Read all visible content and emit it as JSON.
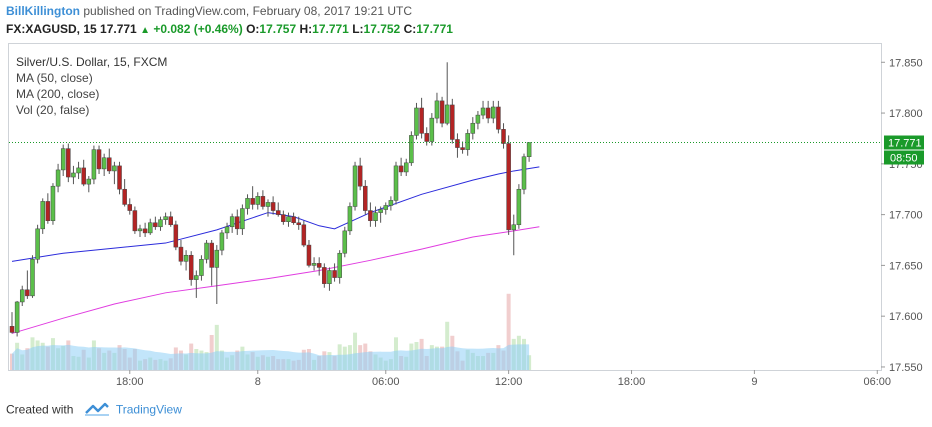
{
  "header": {
    "author": "BillKillington",
    "published": "published on TradingView.com, February 08, 2017 19:21 UTC",
    "symbol": "FX:XAGUSD, 15",
    "last": "17.771",
    "change": "+0.082 (+0.46%)",
    "o_label": "O:",
    "o": "17.757",
    "h_label": "H:",
    "h": "17.771",
    "l_label": "L:",
    "l": "17.752",
    "c_label": "C:",
    "c": "17.771"
  },
  "legend": {
    "title": "Silver/U.S. Dollar, 15, FXCM",
    "ma50": "MA (50, close)",
    "ma200": "MA (200, close)",
    "vol": "Vol (20, false)"
  },
  "footer": {
    "created_with": "Created with",
    "brand": "TradingView"
  },
  "colors": {
    "up": "#5bbf4a",
    "down": "#b32424",
    "ma50": "#2b2bdb",
    "ma200": "#e03ce0",
    "vol_avg": "#8fd0f5",
    "last_price_tag": "#1a9a2a",
    "dotted_line": "#1a9a2a"
  },
  "chart_data": {
    "type": "candlestick",
    "title": "Silver/U.S. Dollar, 15, FXCM",
    "y_ticks": [
      17.55,
      17.6,
      17.65,
      17.7,
      17.75,
      17.8,
      17.85
    ],
    "y_tick_labels": [
      "17.550",
      "17.600",
      "17.650",
      "17.700",
      "17.750",
      "17.800",
      "17.850"
    ],
    "ylim": [
      17.547,
      17.868
    ],
    "x_tick_labels": [
      "18:00",
      "8",
      "06:00",
      "12:00",
      "18:00",
      "9",
      "06:00"
    ],
    "x_tick_bar_index": [
      23,
      48,
      73,
      97,
      121,
      145,
      169
    ],
    "last_price": "17.771",
    "countdown": "08:50",
    "candles": [
      {
        "o": 17.59,
        "h": 17.604,
        "l": 17.583,
        "c": 17.584
      },
      {
        "o": 17.584,
        "h": 17.615,
        "l": 17.58,
        "c": 17.614
      },
      {
        "o": 17.614,
        "h": 17.63,
        "l": 17.61,
        "c": 17.626
      },
      {
        "o": 17.626,
        "h": 17.645,
        "l": 17.617,
        "c": 17.62
      },
      {
        "o": 17.62,
        "h": 17.66,
        "l": 17.618,
        "c": 17.656
      },
      {
        "o": 17.656,
        "h": 17.69,
        "l": 17.652,
        "c": 17.686
      },
      {
        "o": 17.686,
        "h": 17.716,
        "l": 17.681,
        "c": 17.713
      },
      {
        "o": 17.713,
        "h": 17.721,
        "l": 17.691,
        "c": 17.694
      },
      {
        "o": 17.694,
        "h": 17.731,
        "l": 17.69,
        "c": 17.728
      },
      {
        "o": 17.728,
        "h": 17.75,
        "l": 17.722,
        "c": 17.744
      },
      {
        "o": 17.744,
        "h": 17.769,
        "l": 17.738,
        "c": 17.765
      },
      {
        "o": 17.765,
        "h": 17.77,
        "l": 17.732,
        "c": 17.737
      },
      {
        "o": 17.737,
        "h": 17.748,
        "l": 17.73,
        "c": 17.741
      },
      {
        "o": 17.741,
        "h": 17.752,
        "l": 17.735,
        "c": 17.746
      },
      {
        "o": 17.746,
        "h": 17.754,
        "l": 17.728,
        "c": 17.73
      },
      {
        "o": 17.73,
        "h": 17.738,
        "l": 17.722,
        "c": 17.735
      },
      {
        "o": 17.735,
        "h": 17.768,
        "l": 17.73,
        "c": 17.764
      },
      {
        "o": 17.764,
        "h": 17.768,
        "l": 17.74,
        "c": 17.745
      },
      {
        "o": 17.745,
        "h": 17.76,
        "l": 17.738,
        "c": 17.756
      },
      {
        "o": 17.756,
        "h": 17.765,
        "l": 17.74,
        "c": 17.743
      },
      {
        "o": 17.743,
        "h": 17.752,
        "l": 17.73,
        "c": 17.748
      },
      {
        "o": 17.748,
        "h": 17.752,
        "l": 17.72,
        "c": 17.725
      },
      {
        "o": 17.725,
        "h": 17.735,
        "l": 17.708,
        "c": 17.71
      },
      {
        "o": 17.71,
        "h": 17.716,
        "l": 17.7,
        "c": 17.704
      },
      {
        "o": 17.704,
        "h": 17.708,
        "l": 17.681,
        "c": 17.684
      },
      {
        "o": 17.684,
        "h": 17.69,
        "l": 17.678,
        "c": 17.686
      },
      {
        "o": 17.686,
        "h": 17.692,
        "l": 17.678,
        "c": 17.682
      },
      {
        "o": 17.682,
        "h": 17.696,
        "l": 17.68,
        "c": 17.692
      },
      {
        "o": 17.692,
        "h": 17.698,
        "l": 17.685,
        "c": 17.688
      },
      {
        "o": 17.688,
        "h": 17.698,
        "l": 17.684,
        "c": 17.695
      },
      {
        "o": 17.695,
        "h": 17.702,
        "l": 17.69,
        "c": 17.698
      },
      {
        "o": 17.698,
        "h": 17.703,
        "l": 17.688,
        "c": 17.69
      },
      {
        "o": 17.69,
        "h": 17.694,
        "l": 17.665,
        "c": 17.668
      },
      {
        "o": 17.668,
        "h": 17.675,
        "l": 17.65,
        "c": 17.654
      },
      {
        "o": 17.654,
        "h": 17.665,
        "l": 17.645,
        "c": 17.66
      },
      {
        "o": 17.66,
        "h": 17.664,
        "l": 17.63,
        "c": 17.636
      },
      {
        "o": 17.636,
        "h": 17.645,
        "l": 17.618,
        "c": 17.64
      },
      {
        "o": 17.64,
        "h": 17.66,
        "l": 17.635,
        "c": 17.656
      },
      {
        "o": 17.656,
        "h": 17.675,
        "l": 17.652,
        "c": 17.672
      },
      {
        "o": 17.672,
        "h": 17.675,
        "l": 17.63,
        "c": 17.648
      },
      {
        "o": 17.648,
        "h": 17.67,
        "l": 17.612,
        "c": 17.665
      },
      {
        "o": 17.665,
        "h": 17.685,
        "l": 17.66,
        "c": 17.682
      },
      {
        "o": 17.682,
        "h": 17.692,
        "l": 17.676,
        "c": 17.688
      },
      {
        "o": 17.688,
        "h": 17.701,
        "l": 17.682,
        "c": 17.698
      },
      {
        "o": 17.698,
        "h": 17.705,
        "l": 17.68,
        "c": 17.686
      },
      {
        "o": 17.686,
        "h": 17.71,
        "l": 17.68,
        "c": 17.706
      },
      {
        "o": 17.706,
        "h": 17.72,
        "l": 17.7,
        "c": 17.716
      },
      {
        "o": 17.716,
        "h": 17.728,
        "l": 17.705,
        "c": 17.71
      },
      {
        "o": 17.71,
        "h": 17.722,
        "l": 17.705,
        "c": 17.718
      },
      {
        "o": 17.718,
        "h": 17.724,
        "l": 17.705,
        "c": 17.708
      },
      {
        "o": 17.708,
        "h": 17.715,
        "l": 17.698,
        "c": 17.712
      },
      {
        "o": 17.712,
        "h": 17.718,
        "l": 17.7,
        "c": 17.704
      },
      {
        "o": 17.704,
        "h": 17.712,
        "l": 17.698,
        "c": 17.7
      },
      {
        "o": 17.7,
        "h": 17.704,
        "l": 17.69,
        "c": 17.693
      },
      {
        "o": 17.693,
        "h": 17.702,
        "l": 17.688,
        "c": 17.698
      },
      {
        "o": 17.698,
        "h": 17.702,
        "l": 17.69,
        "c": 17.692
      },
      {
        "o": 17.692,
        "h": 17.698,
        "l": 17.685,
        "c": 17.69
      },
      {
        "o": 17.69,
        "h": 17.694,
        "l": 17.668,
        "c": 17.67
      },
      {
        "o": 17.67,
        "h": 17.675,
        "l": 17.648,
        "c": 17.65
      },
      {
        "o": 17.65,
        "h": 17.658,
        "l": 17.645,
        "c": 17.652
      },
      {
        "o": 17.652,
        "h": 17.658,
        "l": 17.64,
        "c": 17.648
      },
      {
        "o": 17.648,
        "h": 17.652,
        "l": 17.628,
        "c": 17.632
      },
      {
        "o": 17.632,
        "h": 17.648,
        "l": 17.625,
        "c": 17.645
      },
      {
        "o": 17.645,
        "h": 17.652,
        "l": 17.634,
        "c": 17.638
      },
      {
        "o": 17.638,
        "h": 17.665,
        "l": 17.632,
        "c": 17.662
      },
      {
        "o": 17.662,
        "h": 17.688,
        "l": 17.658,
        "c": 17.684
      },
      {
        "o": 17.684,
        "h": 17.712,
        "l": 17.68,
        "c": 17.708
      },
      {
        "o": 17.708,
        "h": 17.752,
        "l": 17.704,
        "c": 17.748
      },
      {
        "o": 17.748,
        "h": 17.756,
        "l": 17.724,
        "c": 17.728
      },
      {
        "o": 17.728,
        "h": 17.734,
        "l": 17.7,
        "c": 17.704
      },
      {
        "o": 17.704,
        "h": 17.712,
        "l": 17.688,
        "c": 17.694
      },
      {
        "o": 17.694,
        "h": 17.708,
        "l": 17.688,
        "c": 17.702
      },
      {
        "o": 17.702,
        "h": 17.708,
        "l": 17.692,
        "c": 17.705
      },
      {
        "o": 17.705,
        "h": 17.712,
        "l": 17.7,
        "c": 17.709
      },
      {
        "o": 17.709,
        "h": 17.718,
        "l": 17.704,
        "c": 17.714
      },
      {
        "o": 17.714,
        "h": 17.752,
        "l": 17.71,
        "c": 17.748
      },
      {
        "o": 17.748,
        "h": 17.756,
        "l": 17.738,
        "c": 17.742
      },
      {
        "o": 17.742,
        "h": 17.755,
        "l": 17.738,
        "c": 17.751
      },
      {
        "o": 17.751,
        "h": 17.782,
        "l": 17.748,
        "c": 17.778
      },
      {
        "o": 17.778,
        "h": 17.81,
        "l": 17.774,
        "c": 17.805
      },
      {
        "o": 17.805,
        "h": 17.815,
        "l": 17.775,
        "c": 17.78
      },
      {
        "o": 17.78,
        "h": 17.786,
        "l": 17.768,
        "c": 17.772
      },
      {
        "o": 17.772,
        "h": 17.8,
        "l": 17.768,
        "c": 17.795
      },
      {
        "o": 17.795,
        "h": 17.82,
        "l": 17.79,
        "c": 17.812
      },
      {
        "o": 17.812,
        "h": 17.816,
        "l": 17.786,
        "c": 17.79
      },
      {
        "o": 17.79,
        "h": 17.85,
        "l": 17.788,
        "c": 17.808
      },
      {
        "o": 17.808,
        "h": 17.814,
        "l": 17.77,
        "c": 17.774
      },
      {
        "o": 17.774,
        "h": 17.78,
        "l": 17.756,
        "c": 17.766
      },
      {
        "o": 17.766,
        "h": 17.772,
        "l": 17.76,
        "c": 17.764
      },
      {
        "o": 17.764,
        "h": 17.784,
        "l": 17.758,
        "c": 17.78
      },
      {
        "o": 17.78,
        "h": 17.796,
        "l": 17.774,
        "c": 17.79
      },
      {
        "o": 17.79,
        "h": 17.802,
        "l": 17.784,
        "c": 17.798
      },
      {
        "o": 17.798,
        "h": 17.812,
        "l": 17.794,
        "c": 17.805
      },
      {
        "o": 17.805,
        "h": 17.812,
        "l": 17.79,
        "c": 17.795
      },
      {
        "o": 17.795,
        "h": 17.812,
        "l": 17.79,
        "c": 17.806
      },
      {
        "o": 17.806,
        "h": 17.812,
        "l": 17.78,
        "c": 17.784
      },
      {
        "o": 17.784,
        "h": 17.79,
        "l": 17.765,
        "c": 17.77
      },
      {
        "o": 17.77,
        "h": 17.778,
        "l": 17.68,
        "c": 17.685
      },
      {
        "o": 17.685,
        "h": 17.7,
        "l": 17.66,
        "c": 17.69
      },
      {
        "o": 17.69,
        "h": 17.73,
        "l": 17.686,
        "c": 17.725
      },
      {
        "o": 17.725,
        "h": 17.76,
        "l": 17.72,
        "c": 17.757
      },
      {
        "o": 17.757,
        "h": 17.771,
        "l": 17.752,
        "c": 17.771
      }
    ],
    "ma50": [
      [
        0,
        17.654
      ],
      [
        10,
        17.662
      ],
      [
        20,
        17.667
      ],
      [
        30,
        17.672
      ],
      [
        40,
        17.685
      ],
      [
        50,
        17.702
      ],
      [
        55,
        17.698
      ],
      [
        60,
        17.689
      ],
      [
        63,
        17.686
      ],
      [
        70,
        17.702
      ],
      [
        80,
        17.72
      ],
      [
        90,
        17.734
      ],
      [
        95,
        17.74
      ],
      [
        98,
        17.743
      ],
      [
        103,
        17.747
      ]
    ],
    "ma200": [
      [
        0,
        17.583
      ],
      [
        10,
        17.598
      ],
      [
        20,
        17.612
      ],
      [
        30,
        17.623
      ],
      [
        40,
        17.63
      ],
      [
        50,
        17.637
      ],
      [
        60,
        17.645
      ],
      [
        70,
        17.655
      ],
      [
        80,
        17.666
      ],
      [
        90,
        17.678
      ],
      [
        98,
        17.684
      ],
      [
        103,
        17.688
      ]
    ]
  }
}
